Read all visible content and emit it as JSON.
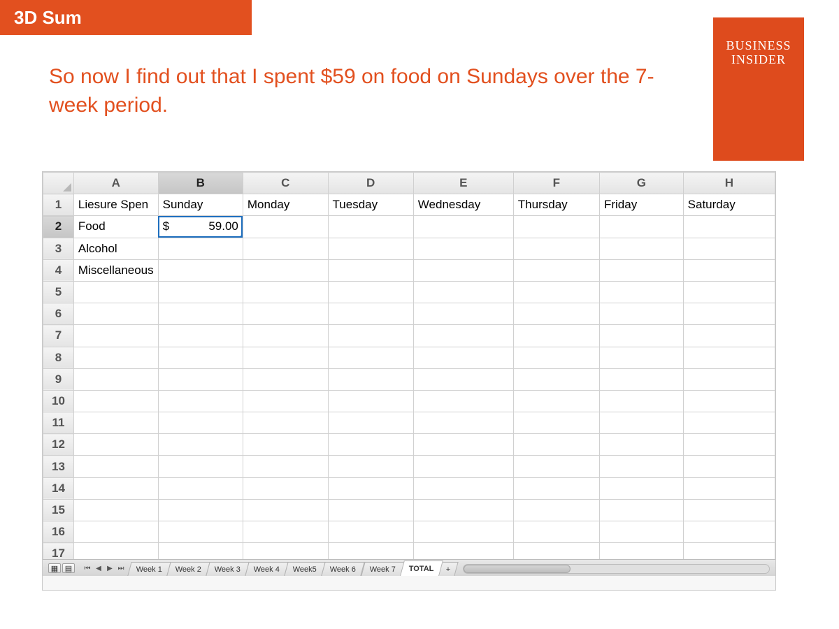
{
  "header": {
    "title": "3D Sum"
  },
  "brand": {
    "line1": "BUSINESS",
    "line2": "INSIDER"
  },
  "caption": "So now I find out that I spent $59 on food on Sundays over the 7-week period.",
  "spreadsheet": {
    "columns": [
      "A",
      "B",
      "C",
      "D",
      "E",
      "F",
      "G",
      "H"
    ],
    "rows": [
      1,
      2,
      3,
      4,
      5,
      6,
      7,
      8,
      9,
      10,
      11,
      12,
      13,
      14,
      15,
      16,
      17
    ],
    "selected_cell": "B2",
    "data": {
      "A1": "Liesure Spen",
      "B1": "Sunday",
      "C1": "Monday",
      "D1": "Tuesday",
      "E1": "Wednesday",
      "F1": "Thursday",
      "G1": "Friday",
      "H1": "Saturday",
      "A2": "Food",
      "B2_dollar": "$",
      "B2_value": "59.00",
      "A3": "Alcohol",
      "A4": "Miscellaneous"
    },
    "tabs": [
      "Week 1",
      "Week 2",
      "Week 3",
      "Week 4",
      "Week5",
      "Week 6",
      "Week 7",
      "TOTAL"
    ],
    "active_tab": "TOTAL",
    "add_tab_label": "+"
  }
}
